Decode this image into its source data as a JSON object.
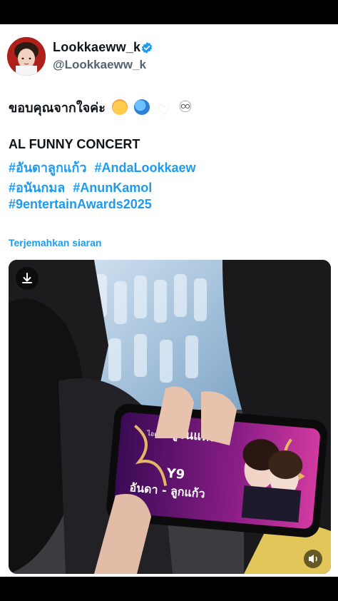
{
  "author": {
    "display_name": "Lookkaeww_k",
    "handle": "@Lookkaeww_k",
    "avatar_icon": "profile-avatar",
    "verified_icon": "verified-badge-icon",
    "verified_color": "#1d9bf0"
  },
  "post": {
    "text": "ขอบคุณจากใจค่ะ",
    "emojis": [
      "smiling-face-with-hearts",
      "globe",
      "white-heart",
      "infinity"
    ],
    "infinity": "♾",
    "line_concert": "AL FUNNY CONCERT",
    "hashtags_row1": [
      "#อันดาลูกแก้ว",
      "#AndaLookkaew"
    ],
    "hashtags_row2": [
      "#อนันกมล",
      "#AnunKamol"
    ],
    "hashtags_row3": [
      "#9entertainAwards2025"
    ],
    "translate_label": "Terjemahkan siaran",
    "link_color": "#1d9bf0"
  },
  "media": {
    "download_icon": "download-icon",
    "sound_icon": "speaker-icon",
    "phone_screen": {
      "small_label": "ไอดอล",
      "award_title": "คู่จิ้นแห่งปี",
      "winner_code": "Y9",
      "winner_names": "อันดา - ลูกแก้ว"
    }
  }
}
